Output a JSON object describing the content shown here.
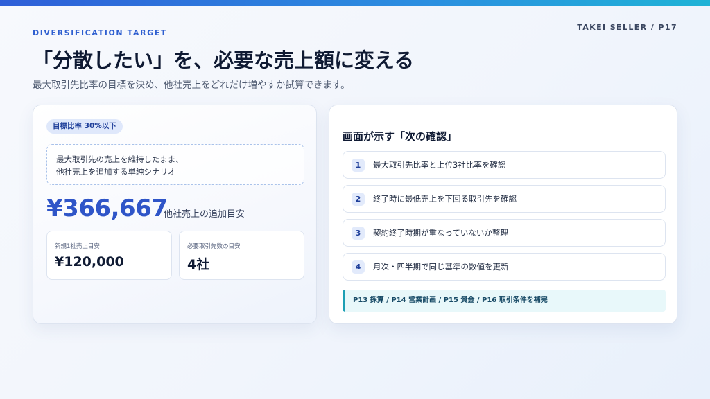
{
  "header": {
    "eyebrow": "DIVERSIFICATION TARGET",
    "page_tag": "TAKEI SELLER / P17",
    "title": "「分散したい」を、必要な売上額に変える",
    "subtitle": "最大取引先比率の目標を決め、他社売上をどれだけ増やすか試算できます。"
  },
  "left_card": {
    "badge": "目標比率 30%以下",
    "scenario_lines": [
      "最大取引先の売上を維持したまま、",
      "他社売上を追加する単純シナリオ"
    ],
    "amount": "¥366,667",
    "amount_caption": "他社売上の追加目安",
    "stats": [
      {
        "label": "新規1社売上目安",
        "value": "¥120,000"
      },
      {
        "label": "必要取引先数の目安",
        "value": "4社"
      }
    ]
  },
  "right_card": {
    "heading": "画面が示す「次の確認」",
    "items": [
      {
        "num": "1",
        "text": "最大取引先比率と上位3社比率を確認"
      },
      {
        "num": "2",
        "text": "終了時に最低売上を下回る取引先を確認"
      },
      {
        "num": "3",
        "text": "契約終了時期が重なっていないか整理"
      },
      {
        "num": "4",
        "text": "月次・四半期で同じ基準の数値を更新"
      }
    ],
    "note": "P13 採算 / P14 営業計画 / P15 資金 / P16 取引条件を補完"
  },
  "colors": {
    "accent": "#2f55c8",
    "badge_bg": "#dfe8fb",
    "note_border": "#1d9fb4",
    "note_bg": "#e8f8fa"
  }
}
